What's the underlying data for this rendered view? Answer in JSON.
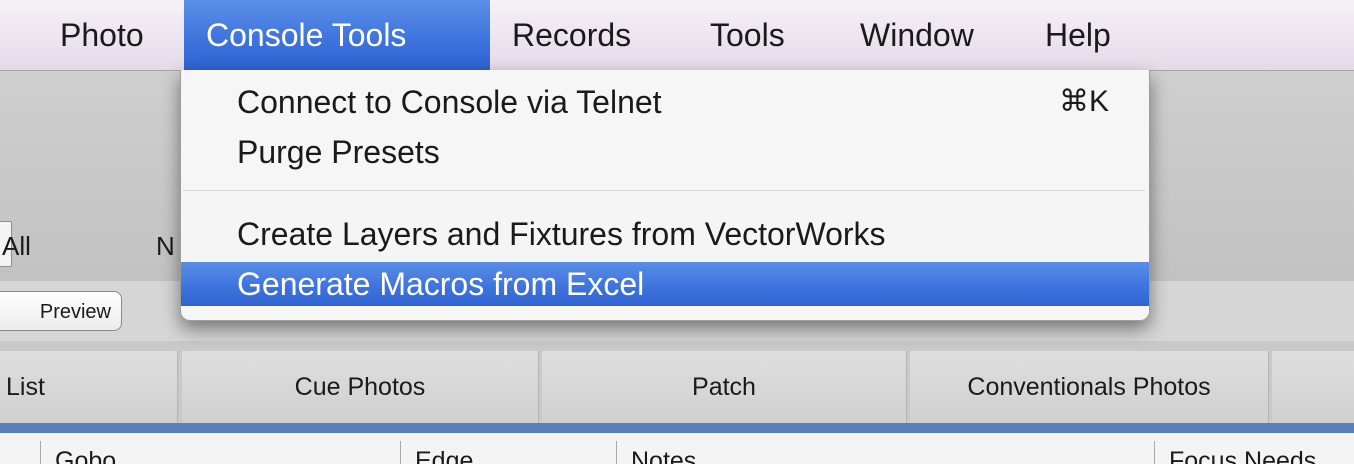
{
  "menubar": {
    "items": [
      {
        "label": "Photo",
        "active": false
      },
      {
        "label": "Console Tools",
        "active": true
      },
      {
        "label": "Records",
        "active": false
      },
      {
        "label": "Tools",
        "active": false
      },
      {
        "label": "Window",
        "active": false
      },
      {
        "label": "Help",
        "active": false
      }
    ]
  },
  "dropdown": {
    "items": [
      {
        "label": "Connect to Console via Telnet",
        "shortcut": "⌘K"
      },
      {
        "label": "Purge Presets"
      },
      {
        "label": "Create Layers and Fixtures from VectorWorks"
      },
      {
        "label": "Generate Macros from Excel",
        "highlighted": true
      }
    ]
  },
  "toolbar": {
    "label_all": "All",
    "label_n": "N"
  },
  "preview_button": {
    "label": "Preview"
  },
  "tabs": [
    "List",
    "Cue Photos",
    "Patch",
    "Conventionals Photos"
  ],
  "table": {
    "columns": [
      "Gobo",
      "Edge",
      "Notes",
      "Focus Needs"
    ]
  },
  "colors": {
    "highlight": "#3f74de",
    "menubar": "#efe7f1",
    "tab_strip": "#5c7fb8"
  }
}
